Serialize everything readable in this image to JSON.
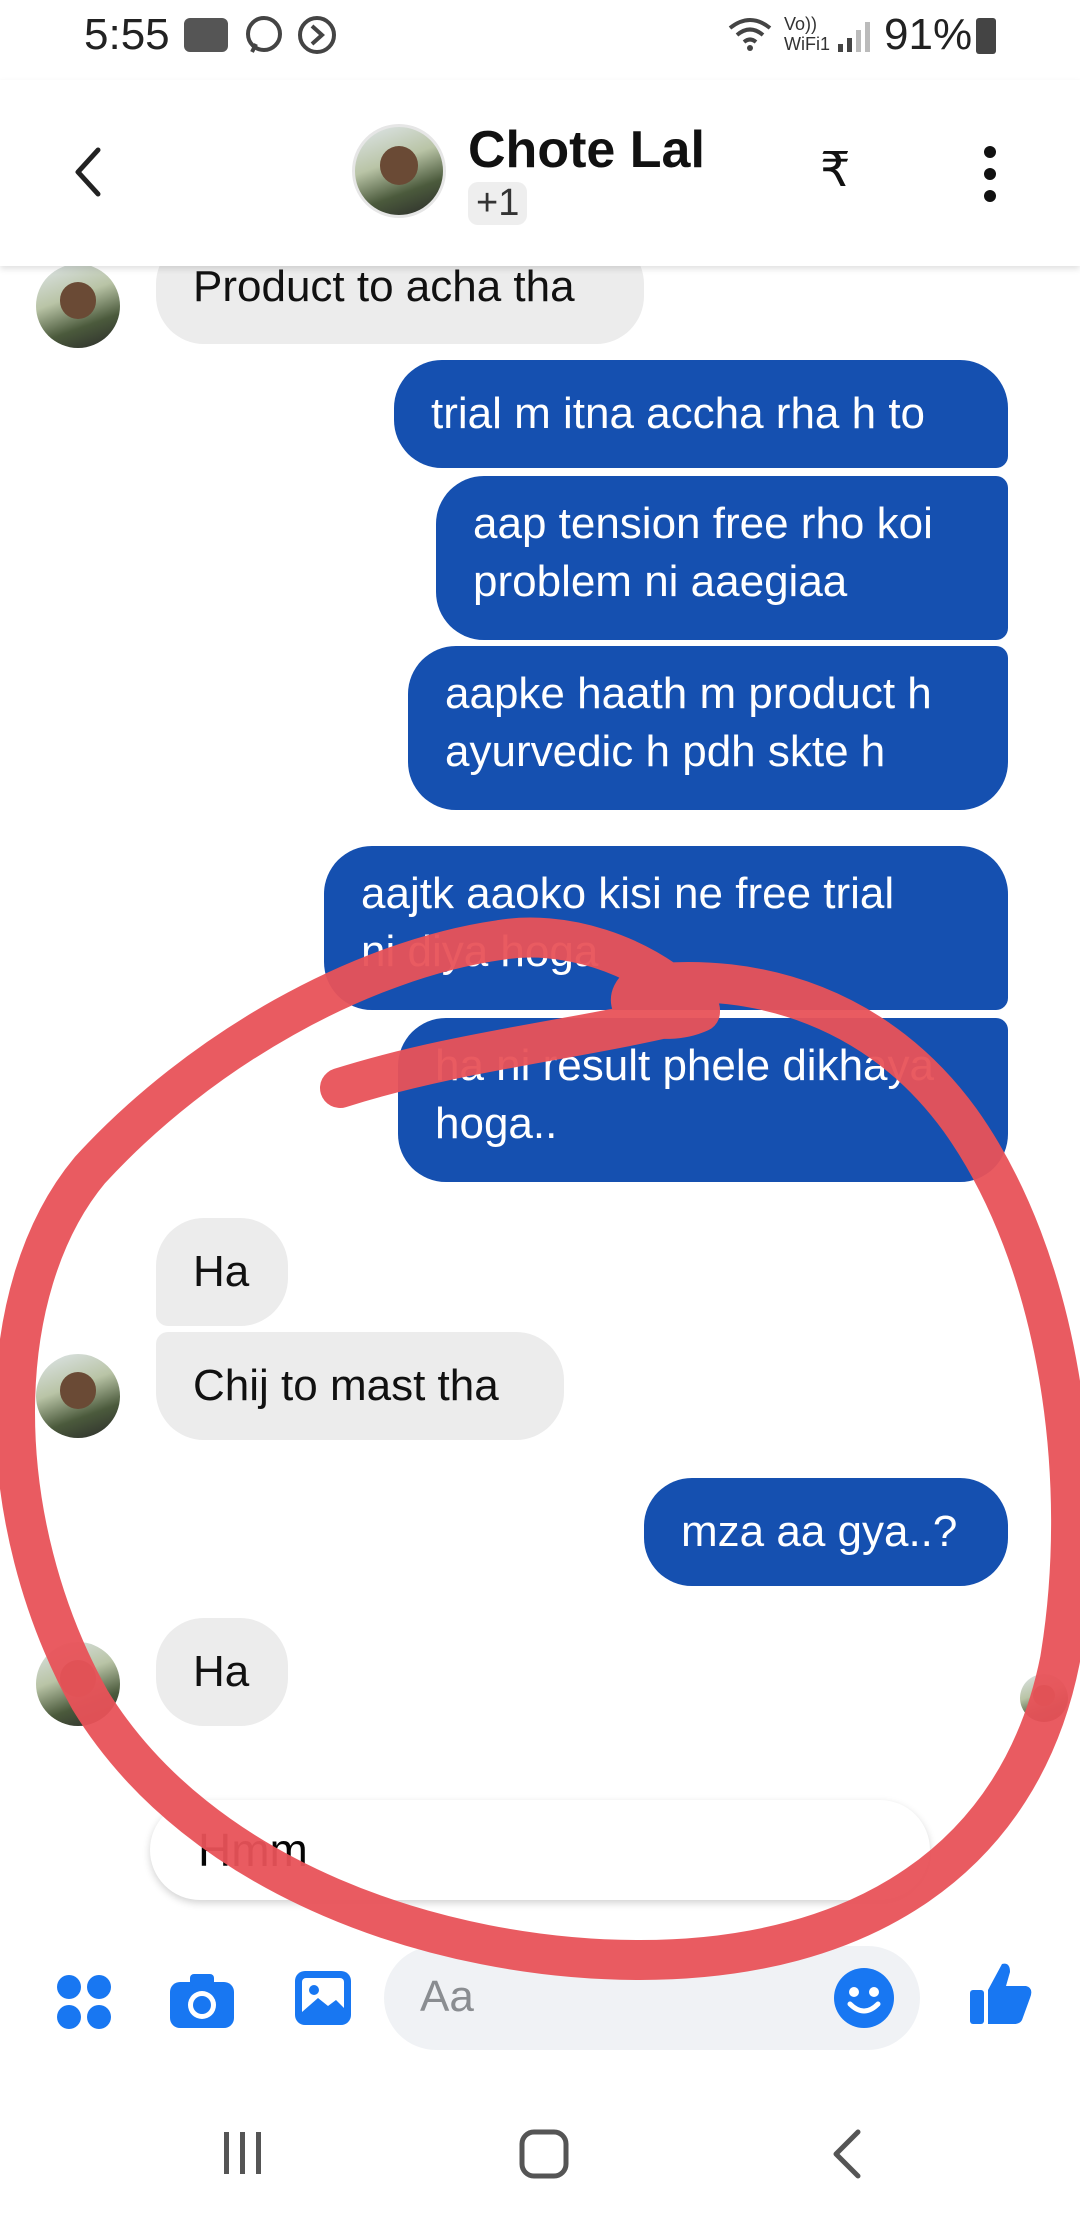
{
  "status_bar": {
    "time": "5:55",
    "network_label": "Vo)) WiFi1",
    "battery": "91%"
  },
  "header": {
    "contact_name": "Chote Lal",
    "extra_participants": "+1",
    "back_icon": "chevron-left-icon",
    "payment_icon": "rupee-icon",
    "menu_icon": "more-vertical-icon"
  },
  "messages": [
    {
      "side": "in",
      "text": "Product to acha tha"
    },
    {
      "side": "out",
      "text": "trial m itna accha rha h to"
    },
    {
      "side": "out",
      "line1": "aap tension free rho koi",
      "line2": "problem ni aaegiaa"
    },
    {
      "side": "out",
      "line1": "aapke haath m product h",
      "line2": "ayurvedic h pdh skte h"
    },
    {
      "side": "out",
      "line1": "aajtk aaoko kisi ne free trial",
      "line2": "ni diya hoga"
    },
    {
      "side": "out",
      "line1": "ha ni result phele dikhaya",
      "line2": "hoga.."
    },
    {
      "side": "in",
      "text": "Ha"
    },
    {
      "side": "in",
      "text": "Chij to mast tha"
    },
    {
      "side": "out",
      "text": "mza aa gya..?"
    },
    {
      "side": "in",
      "text": "Ha"
    }
  ],
  "reply_preview": "Hmm",
  "composer": {
    "placeholder": "Aa"
  },
  "colors": {
    "accent": "#1877f2",
    "outgoing_bubble": "#1550b0",
    "incoming_bubble": "#ececec",
    "annotation": "#e85258"
  }
}
